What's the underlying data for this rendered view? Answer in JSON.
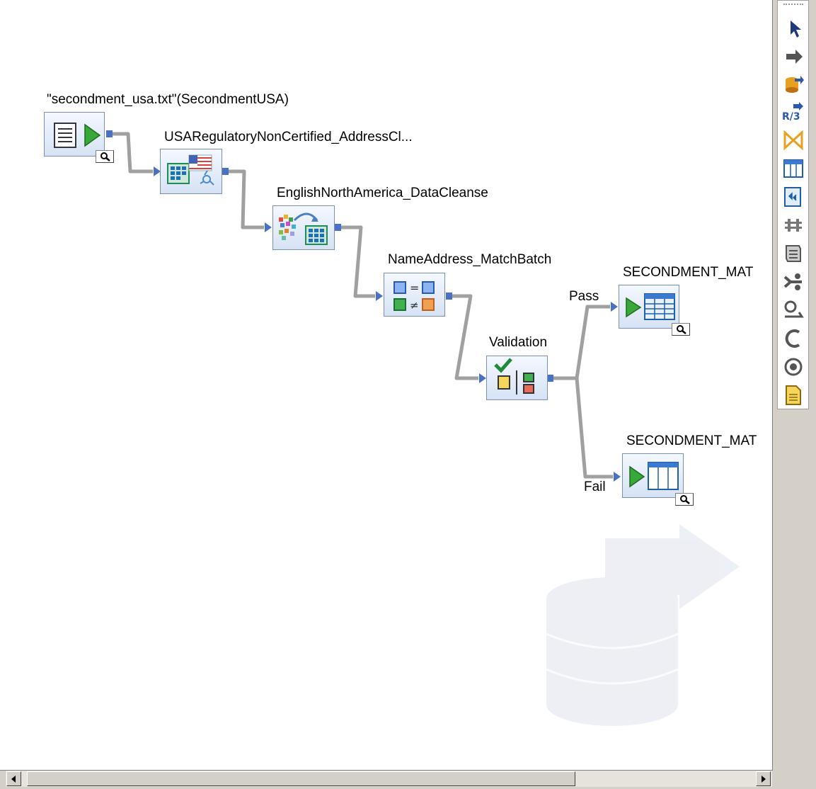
{
  "canvas": {
    "nodes": [
      {
        "label": "\"secondment_usa.txt\"(SecondmentUSA)",
        "icon": "source-file-icon"
      },
      {
        "label": "USARegulatoryNonCertified_AddressCl...",
        "icon": "address-cleanse-icon"
      },
      {
        "label": "EnglishNorthAmerica_DataCleanse",
        "icon": "data-cleanse-icon"
      },
      {
        "label": "NameAddress_MatchBatch",
        "icon": "match-icon"
      },
      {
        "label": "Validation",
        "icon": "validation-icon"
      },
      {
        "label": "SECONDMENT_MAT",
        "icon": "target-table-icon"
      },
      {
        "label": "SECONDMENT_MAT",
        "icon": "target-table-icon"
      }
    ],
    "branches": {
      "pass": "Pass",
      "fail": "Fail"
    }
  },
  "palette": {
    "tools": [
      "pointer-icon",
      "data-flow-icon",
      "datastore-icon",
      "r3-dataflow-icon",
      "query-transform-icon",
      "template-table-icon",
      "template-xml-icon",
      "data-transport-icon",
      "script-icon",
      "conditional-icon",
      "try-icon",
      "catch-icon",
      "while-loop-icon",
      "annotation-icon"
    ],
    "r3_text": "R/3"
  },
  "colors": {
    "wire": "#a0a0a0",
    "port": "#4a72c4",
    "arrow": "#3aa63a"
  }
}
